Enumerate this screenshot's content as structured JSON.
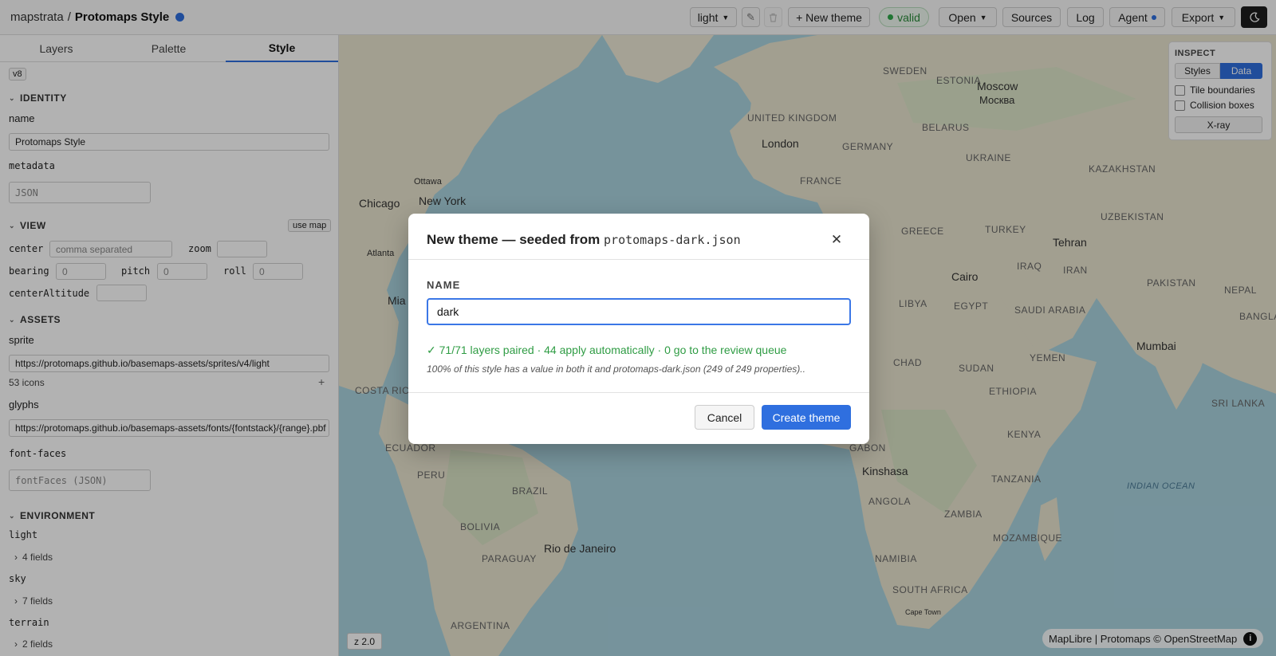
{
  "header": {
    "app_name": "mapstrata",
    "separator": "/",
    "project_name": "Protomaps Style",
    "theme_select": "light",
    "new_theme_label": "+ New theme",
    "valid_label": "valid",
    "open_label": "Open",
    "sources_label": "Sources",
    "log_label": "Log",
    "agent_label": "Agent",
    "export_label": "Export"
  },
  "sidebar": {
    "tabs": [
      "Layers",
      "Palette",
      "Style"
    ],
    "active_tab": "Style",
    "version_badge": "v8",
    "identity": {
      "title": "IDENTITY",
      "name_label": "name",
      "name_value": "Protomaps Style",
      "metadata_label": "metadata",
      "metadata_placeholder": "JSON"
    },
    "view": {
      "title": "VIEW",
      "use_map_label": "use map",
      "center_label": "center",
      "center_placeholder": "comma separated",
      "zoom_label": "zoom",
      "bearing_label": "bearing",
      "bearing_value": "0",
      "pitch_label": "pitch",
      "pitch_value": "0",
      "roll_label": "roll",
      "roll_value": "0",
      "center_altitude_label": "centerAltitude"
    },
    "assets": {
      "title": "ASSETS",
      "sprite_label": "sprite",
      "sprite_value": "https://protomaps.github.io/basemaps-assets/sprites/v4/light",
      "icons_count": "53 icons",
      "add_symbol": "+",
      "glyphs_label": "glyphs",
      "glyphs_value": "https://protomaps.github.io/basemaps-assets/fonts/{fontstack}/{range}.pbf",
      "font_faces_label": "font-faces",
      "font_faces_placeholder": "fontFaces (JSON)"
    },
    "environment": {
      "title": "ENVIRONMENT",
      "light_label": "light",
      "light_fields": "4 fields",
      "sky_label": "sky",
      "sky_fields": "7 fields",
      "terrain_label": "terrain",
      "terrain_fields": "2 fields"
    }
  },
  "map": {
    "inspect": {
      "title": "INSPECT",
      "styles_label": "Styles",
      "data_label": "Data",
      "tile_boundaries_label": "Tile boundaries",
      "collision_boxes_label": "Collision boxes",
      "xray_label": "X-ray"
    },
    "zoom_indicator": "z 2.0",
    "attribution": "MapLibre | Protomaps © OpenStreetMap",
    "labels": {
      "sweden": "SWEDEN",
      "estonia": "ESTONIA",
      "moscow": "Moscow",
      "moscow_local": "Москва",
      "united_kingdom": "UNITED KINGDOM",
      "belarus": "BELARUS",
      "london": "London",
      "germany": "GERMANY",
      "ukraine": "UKRAINE",
      "kazakhstan": "KAZAKHSTAN",
      "ottawa": "Ottawa",
      "new_york": "New York",
      "chicago": "Chicago",
      "france": "FRANCE",
      "uzbekistan": "UZBEKISTAN",
      "greece": "GREECE",
      "turkey": "TURKEY",
      "tehran": "Tehran",
      "atlanta": "Atlanta",
      "iraq": "IRAQ",
      "iran": "IRAN",
      "cairo": "Cairo",
      "pakistan": "PAKISTAN",
      "nepal": "NEPAL",
      "miami": "Mia",
      "libya": "LIBYA",
      "egypt": "EGYPT",
      "saudi_arabia": "SAUDI ARABIA",
      "bangladesh": "BANGLAD",
      "yemen": "YEMEN",
      "mumbai": "Mumbai",
      "chad": "CHAD",
      "sudan": "SUDAN",
      "costa_rica": "COSTA RIC",
      "ethiopia": "ETHIOPIA",
      "sri_lanka": "SRI LANKA",
      "kenya": "KENYA",
      "gabon": "GABON",
      "ecuador": "ECUADOR",
      "kinshasa": "Kinshasa",
      "peru": "PERU",
      "tanzania": "TANZANIA",
      "brazil": "BRAZIL",
      "indian_ocean": "INDIAN OCEAN",
      "angola": "ANGOLA",
      "zambia": "ZAMBIA",
      "bolivia": "BOLIVIA",
      "mozambique": "MOZAMBIQUE",
      "rio": "Rio de Janeiro",
      "paraguay": "PARAGUAY",
      "namibia": "NAMIBIA",
      "south_africa": "SOUTH AFRICA",
      "cape_town": "Cape Town",
      "argentina": "ARGENTINA"
    }
  },
  "modal": {
    "title_prefix": "New theme — seeded from",
    "title_file": "protomaps-dark.json",
    "name_label": "NAME",
    "name_value": "dark",
    "pairing_status": "✓ 71/71 layers paired · 44 apply automatically · 0 go to the review queue",
    "coverage_note": "100% of this style has a value in both it and protomaps-dark.json (249 of 249 properties)..",
    "cancel_label": "Cancel",
    "create_label": "Create theme"
  },
  "colors": {
    "accent": "#2f6fdf",
    "valid_green": "#2fa84a",
    "ocean": "#a9d3df",
    "land": "#e9e4cf"
  }
}
